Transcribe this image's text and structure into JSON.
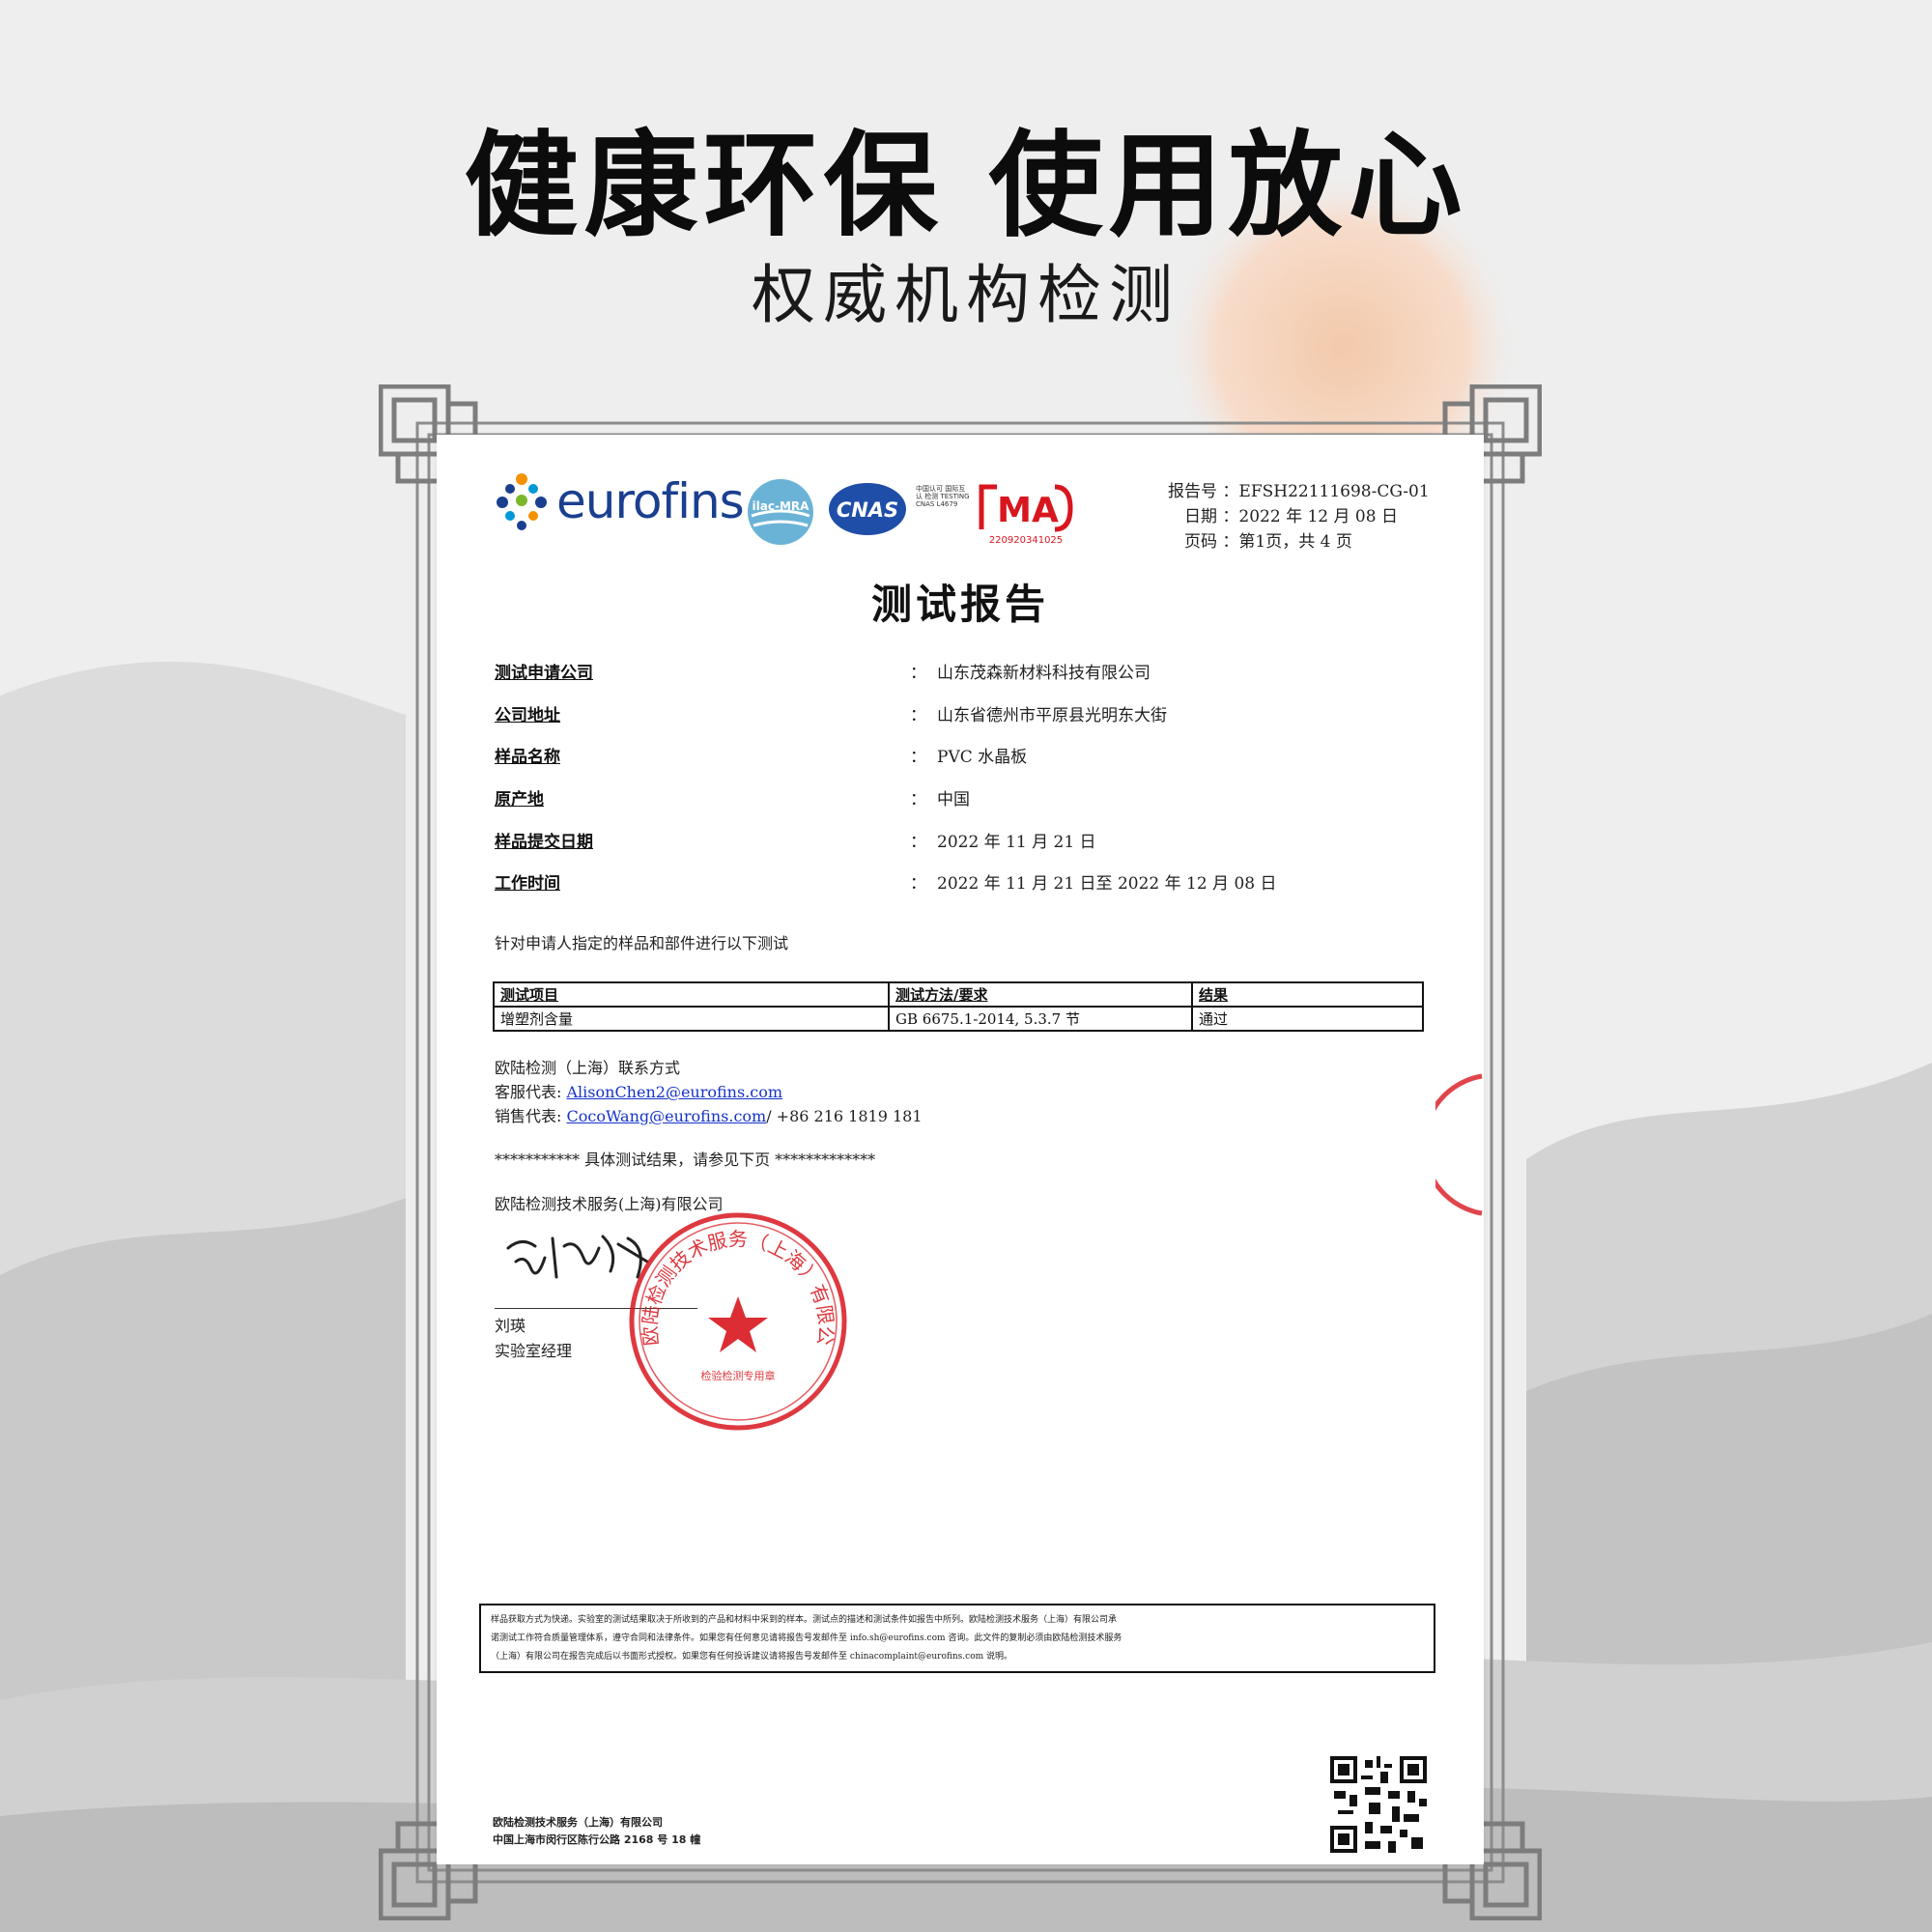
{
  "hero": {
    "headline": "健康环保 使用放心",
    "subline": "权威机构检测"
  },
  "logos": {
    "eurofins": "eurofins",
    "ilac": "ilac-MRA",
    "cnas": "CNAS",
    "cnas_note": "中国认可 国际互认 检测 TESTING CNAS L4679",
    "cma": "MA",
    "cma_number": "220920341025"
  },
  "meta": {
    "report_label": "报告号",
    "report_value": "：EFSH22111698-CG-01",
    "date_label": "日期",
    "date_value": "：2022 年 12 月 08 日",
    "page_label": "页码",
    "page_value": "：第1页，共 4 页"
  },
  "doc_title": "测试报告",
  "fields": [
    {
      "label": "测试申请公司",
      "colon": "：",
      "value": "山东茂森新材料科技有限公司"
    },
    {
      "label": "公司地址",
      "colon": "：",
      "value": "山东省德州市平原县光明东大街"
    },
    {
      "label": "样品名称",
      "colon": "：",
      "value": "PVC 水晶板"
    },
    {
      "label": "原产地",
      "colon": "：",
      "value": "中国"
    },
    {
      "label": "样品提交日期",
      "colon": "：",
      "value": "2022 年 11 月 21 日"
    },
    {
      "label": "工作时间",
      "colon": "：",
      "value": "2022 年 11 月 21 日至 2022 年 12 月 08 日"
    }
  ],
  "intro": "针对申请人指定的样品和部件进行以下测试",
  "tests": {
    "headers": [
      "测试项目",
      "测试方法/要求",
      "结果"
    ],
    "rows": [
      [
        "增塑剂含量",
        "GB 6675.1-2014, 5.3.7 节",
        "通过"
      ]
    ]
  },
  "contact": {
    "title": "欧陆检测（上海）联系方式",
    "cs_label": "客服代表:",
    "cs_email": "AlisonChen2@eurofins.com",
    "sales_label": "销售代表:",
    "sales_email": "CocoWang@eurofins.com",
    "sales_phone": "/ +86 216 1819 181"
  },
  "stars_line": "*********** 具体测试结果，请参见下页 *************",
  "company_line": "欧陆检测技术服务(上海)有限公司",
  "signer": {
    "name": "刘瑛",
    "title": "实验室经理"
  },
  "seal": {
    "text": "欧陆检测技术服务（上海）有限公司",
    "inner": "检验检测专用章"
  },
  "disclaimer": [
    "样品获取方式为快递。实验室的测试结果取决于所收到的产品和材料中采到的样本。测试点的描述和测试条件如报告中所列。欧陆检测技术服务（上海）有限公司承",
    "诺测试工作符合质量管理体系，遵守合同和法律条件。如果您有任何意见请将报告号发邮件至 info.sh@eurofins.com 咨询。此文件的复制必须由欧陆检测技术服务",
    "（上海）有限公司在报告完成后以书面形式授权。如果您有任何投诉建议请将报告号发邮件至 chinacomplaint@eurofins.com 说明。"
  ],
  "footer": {
    "line1": "欧陆检测技术服务（上海）有限公司",
    "line2": "中国上海市闵行区陈行公路 2168 号 18 幢"
  },
  "colors": {
    "brand_blue": "#1a3f8f",
    "seal_red": "#d8161e",
    "link_blue": "#1633c8"
  }
}
